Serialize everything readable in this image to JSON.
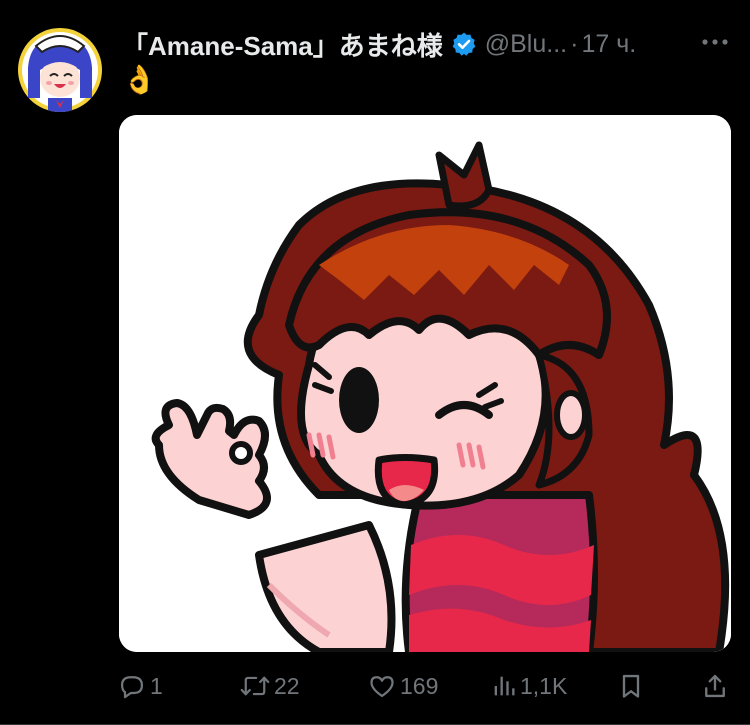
{
  "tweet": {
    "display_name": "「Amane-Sama」あまね様",
    "handle": "@Blu...",
    "separator": "·",
    "time": "17 ч.",
    "text": "👌"
  },
  "actions": {
    "reply_count": "1",
    "repost_count": "22",
    "like_count": "169",
    "views_count": "1,1K"
  },
  "icons": {
    "verified": "verified-badge-icon",
    "more": "more-horizontal-icon",
    "reply": "reply-icon",
    "repost": "repost-icon",
    "like": "heart-icon",
    "views": "views-icon",
    "bookmark": "bookmark-icon",
    "share": "share-icon"
  },
  "colors": {
    "background": "#000000",
    "text_primary": "#e7e9ea",
    "text_secondary": "#71767b",
    "verified_blue": "#1d9bf0"
  }
}
